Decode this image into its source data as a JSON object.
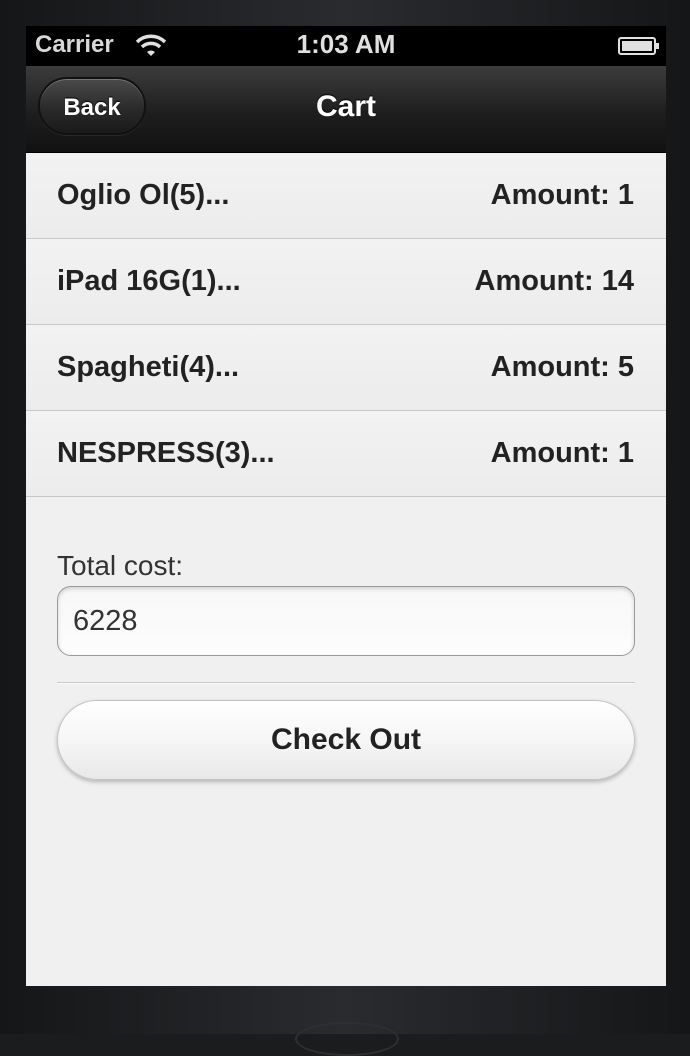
{
  "status_bar": {
    "carrier": "Carrier",
    "time": "1:03 AM",
    "wifi_icon": "wifi-icon",
    "battery_icon": "battery-icon"
  },
  "navbar": {
    "back_label": "Back",
    "title": "Cart"
  },
  "cart_items": [
    {
      "name": "Oglio Ol(5)...",
      "amount": "Amount: 1"
    },
    {
      "name": "iPad 16G(1)...",
      "amount": "Amount: 14"
    },
    {
      "name": "Spagheti(4)...",
      "amount": "Amount: 5"
    },
    {
      "name": "NESPRESS(3)...",
      "amount": "Amount: 1"
    }
  ],
  "total": {
    "label": "Total cost:",
    "value": "6228"
  },
  "checkout": {
    "label": "Check Out"
  }
}
